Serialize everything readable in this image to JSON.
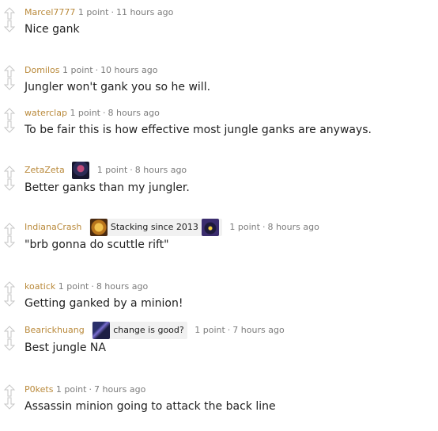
{
  "comments": [
    {
      "author": "Marcel7777",
      "points": "1 point",
      "time": "11 hours ago",
      "text": "Nice gank"
    },
    {
      "author": "Domilos",
      "points": "1 point",
      "time": "10 hours ago",
      "text": "Jungler won't gank you so he will."
    },
    {
      "author": "waterclap",
      "points": "1 point",
      "time": "8 hours ago",
      "text": "To be fair this is how effective most jungle ganks are anyways."
    },
    {
      "author": "ZetaZeta",
      "points": "1 point",
      "time": "8 hours ago",
      "text": "Better ganks than my jungler.",
      "flair_icon": "champion-portrait-icon"
    },
    {
      "author": "IndianaCrash",
      "points": "1 point",
      "time": "8 hours ago",
      "text": "\"brb gonna do scuttle rift\"",
      "flair_text": "Stacking since 2013",
      "flair_icon": "mejais-icon",
      "flair_icon_2": "veigar-icon"
    },
    {
      "author": "koatick",
      "points": "1 point",
      "time": "8 hours ago",
      "text": "Getting ganked by a minion!"
    },
    {
      "author": "Bearickhuang",
      "points": "1 point",
      "time": "7 hours ago",
      "text": "Best jungle NA",
      "flair_text": "change is good?",
      "flair_icon": "champion-portrait-icon"
    },
    {
      "author": "P0kets",
      "points": "1 point",
      "time": "7 hours ago",
      "text": "Assassin minion going to attack the back line"
    }
  ],
  "separator": "·",
  "colors": {
    "author": "#b9893a",
    "meta": "#7c7c7c",
    "arrow": "#c6c6c6"
  }
}
